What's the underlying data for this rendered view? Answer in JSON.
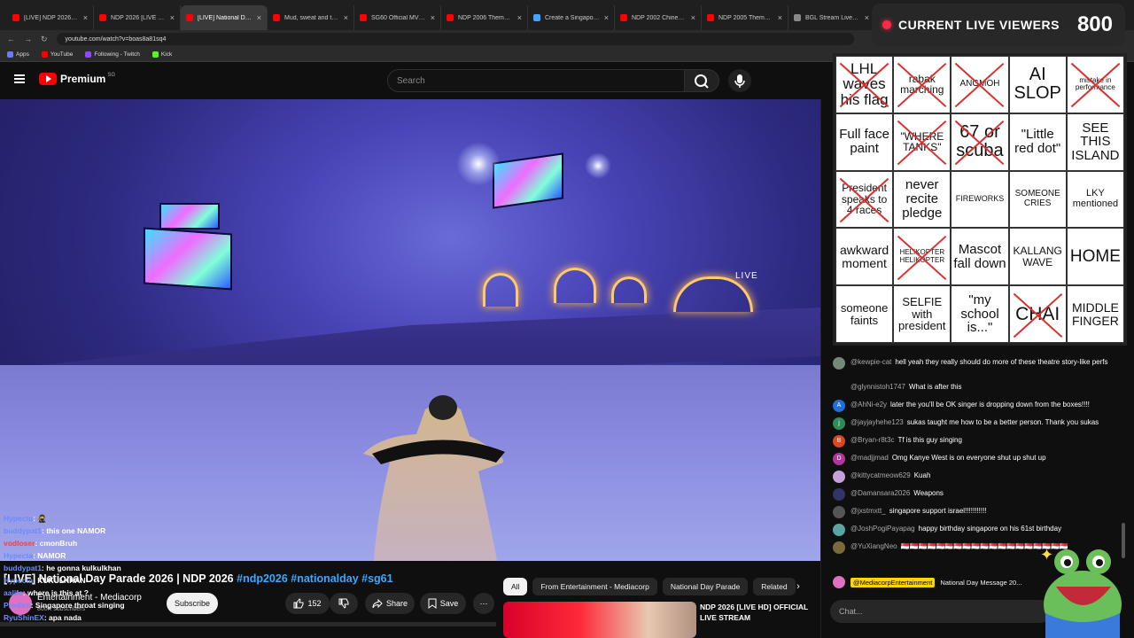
{
  "browser": {
    "tabs": [
      {
        "title": "[LIVE] NDP 2026: Singa...",
        "icon": "youtube-icon",
        "active": false
      },
      {
        "title": "NDP 2026 [LIVE HD] OF...",
        "icon": "youtube-icon",
        "active": false
      },
      {
        "title": "[LIVE] National Day ...",
        "icon": "youtube-icon",
        "active": true
      },
      {
        "title": "Mud, sweat and tears |...",
        "icon": "youtube-icon",
        "active": false
      },
      {
        "title": "SG60 Official MV (Koala...",
        "icon": "youtube-icon",
        "active": false
      },
      {
        "title": "NDP 2006 Theme Song...",
        "icon": "youtube-icon",
        "active": false
      },
      {
        "title": "Create a Singapore ND...",
        "icon": "doc-icon",
        "active": false
      },
      {
        "title": "NDP 2002 Chinese Them...",
        "icon": "youtube-icon",
        "active": false
      },
      {
        "title": "NDP 2005 Theme Song...",
        "icon": "youtube-icon",
        "active": false
      },
      {
        "title": "BGL Stream Live Views",
        "icon": "web-icon",
        "active": false
      }
    ],
    "url": "youtube.com/watch?v=boas8a81sq4",
    "bookmarks": [
      "Apps",
      "YouTube",
      "Following - Twitch",
      "Kick"
    ]
  },
  "youtube": {
    "logo_text": "Premium",
    "logo_region": "SG",
    "search_placeholder": "Search",
    "live_label": "LIVE",
    "overlay_chat": [
      {
        "user": "Hypecta",
        "msg": "🥷",
        "red": false
      },
      {
        "user": "buddypat1",
        "msg": "this one NAMOR",
        "red": false
      },
      {
        "user": "vodloser",
        "msg": "cmonBruh",
        "red": true
      },
      {
        "user": "Hypecta",
        "msg": "NAMOR",
        "red": false
      },
      {
        "user": "buddypat1",
        "msg": "he gonna kulkulkhan",
        "red": false
      },
      {
        "user": "Hypecta",
        "msg": "KUKULKHAN",
        "red": false
      },
      {
        "user": "aalife",
        "msg": "where is this at ?",
        "red": false
      },
      {
        "user": "Predice",
        "msg": "Singapore throat singing",
        "red": false
      },
      {
        "user": "RyuShinEX",
        "msg": "apa nada",
        "red": false
      }
    ],
    "video_title": "[LIVE] National Day Parade 2026 | NDP 2026",
    "video_tags": "#ndp2026 #nationalday #sg61",
    "channel_name": "Entertainment - Mediacorp",
    "channel_subs": "800K subscribers",
    "subscribe_label": "Subscribe",
    "like_count": "152",
    "share_label": "Share",
    "save_label": "Save",
    "chips": [
      "All",
      "From Entertainment - Mediacorp",
      "National Day Parade",
      "Related"
    ],
    "recommended_title": "NDP 2026 [LIVE HD] OFFICIAL LIVE STREAM"
  },
  "viewer_counter": {
    "label": "CURRENT LIVE VIEWERS",
    "count": "800"
  },
  "bingo": [
    {
      "text": "LHL waves his flag",
      "size": 17,
      "crossed": true
    },
    {
      "text": "rabak marching",
      "size": 12,
      "crossed": true
    },
    {
      "text": "ANGMOH",
      "size": 10,
      "crossed": true
    },
    {
      "text": "AI SLOP",
      "size": 20,
      "crossed": false
    },
    {
      "text": "mistake in performance",
      "size": 8,
      "crossed": true
    },
    {
      "text": "Full face paint",
      "size": 15,
      "crossed": false
    },
    {
      "text": "\"WHERE TANKS\"",
      "size": 12,
      "crossed": true
    },
    {
      "text": "67 or scuba",
      "size": 20,
      "crossed": true
    },
    {
      "text": "\"Little red dot\"",
      "size": 15,
      "crossed": false
    },
    {
      "text": "SEE THIS ISLAND",
      "size": 15,
      "crossed": false
    },
    {
      "text": "President speaks to 4 races",
      "size": 12,
      "crossed": true
    },
    {
      "text": "never recite pledge",
      "size": 15,
      "crossed": false
    },
    {
      "text": "FIREWORKS",
      "size": 9,
      "crossed": false
    },
    {
      "text": "SOMEONE CRIES",
      "size": 10,
      "crossed": false
    },
    {
      "text": "LKY mentioned",
      "size": 11,
      "crossed": false
    },
    {
      "text": "awkward moment",
      "size": 14,
      "crossed": false
    },
    {
      "text": "HELIKOPTER HELIKOPTER",
      "size": 8,
      "crossed": true
    },
    {
      "text": "Mascot fall down",
      "size": 15,
      "crossed": false
    },
    {
      "text": "KALLANG WAVE",
      "size": 12,
      "crossed": false
    },
    {
      "text": "HOME",
      "size": 19,
      "crossed": false
    },
    {
      "text": "someone faints",
      "size": 13,
      "crossed": false
    },
    {
      "text": "SELFIE with president",
      "size": 13,
      "crossed": false
    },
    {
      "text": "\"my school is...\"",
      "size": 15,
      "crossed": false
    },
    {
      "text": "CHAI",
      "size": 21,
      "crossed": true
    },
    {
      "text": "MIDDLE FINGER",
      "size": 14,
      "crossed": false
    }
  ],
  "chat": [
    {
      "user": "@kewpie-cat",
      "msg": "hell yeah they really should do more of these theatre story-like perfs",
      "avatar": "",
      "color": "#778877"
    },
    {
      "user": "@glynnistoh1747",
      "msg": "What is after this",
      "avatar": "",
      "color": "#0f0f0f"
    },
    {
      "user": "@AhNi-e2y",
      "msg": "later the you'll be OK singer is dropping down from the boxes!!!!",
      "avatar": "A",
      "color": "#1e6fd9"
    },
    {
      "user": "@jayjayhehe123",
      "msg": "sukas taught me how to be a better person. Thank you sukas",
      "avatar": "j",
      "color": "#2e8b57"
    },
    {
      "user": "@Bryan-r8t3c",
      "msg": "Tf is this guy singing",
      "avatar": "B",
      "color": "#d9481e"
    },
    {
      "user": "@madjjmad",
      "msg": "Omg Kanye West is on everyone shut up shut up",
      "avatar": "D",
      "color": "#b0379a"
    },
    {
      "user": "@kittycatmeow629",
      "msg": "Kuah",
      "avatar": "",
      "color": "#c8a0d8"
    },
    {
      "user": "@Damansara2026",
      "msg": "Weapons",
      "avatar": "",
      "color": "#333366"
    },
    {
      "user": "@jxstmxtt_",
      "msg": "singapore support israel!!!!!!!!!!!",
      "avatar": "",
      "color": "#555"
    },
    {
      "user": "@JoshPogiPayapag",
      "msg": "happy birthday singapore on his 61st birthday",
      "avatar": "",
      "color": "#5ba4a4"
    },
    {
      "user": "@YuXiangNeo",
      "msg": "🇸🇬🇸🇬🇸🇬🇸🇬🇸🇬🇸🇬🇸🇬🇸🇬🇸🇬🇸🇬🇸🇬🇸🇬🇸🇬🇸🇬🇸🇬🇸🇬🇸🇬🇸🇬🇸🇬",
      "avatar": "",
      "color": "#7a6a3a"
    }
  ],
  "pinned": {
    "user": "@MediacorpEntertainment",
    "msg": "National Day Message 20..."
  },
  "chat_placeholder": "Chat..."
}
